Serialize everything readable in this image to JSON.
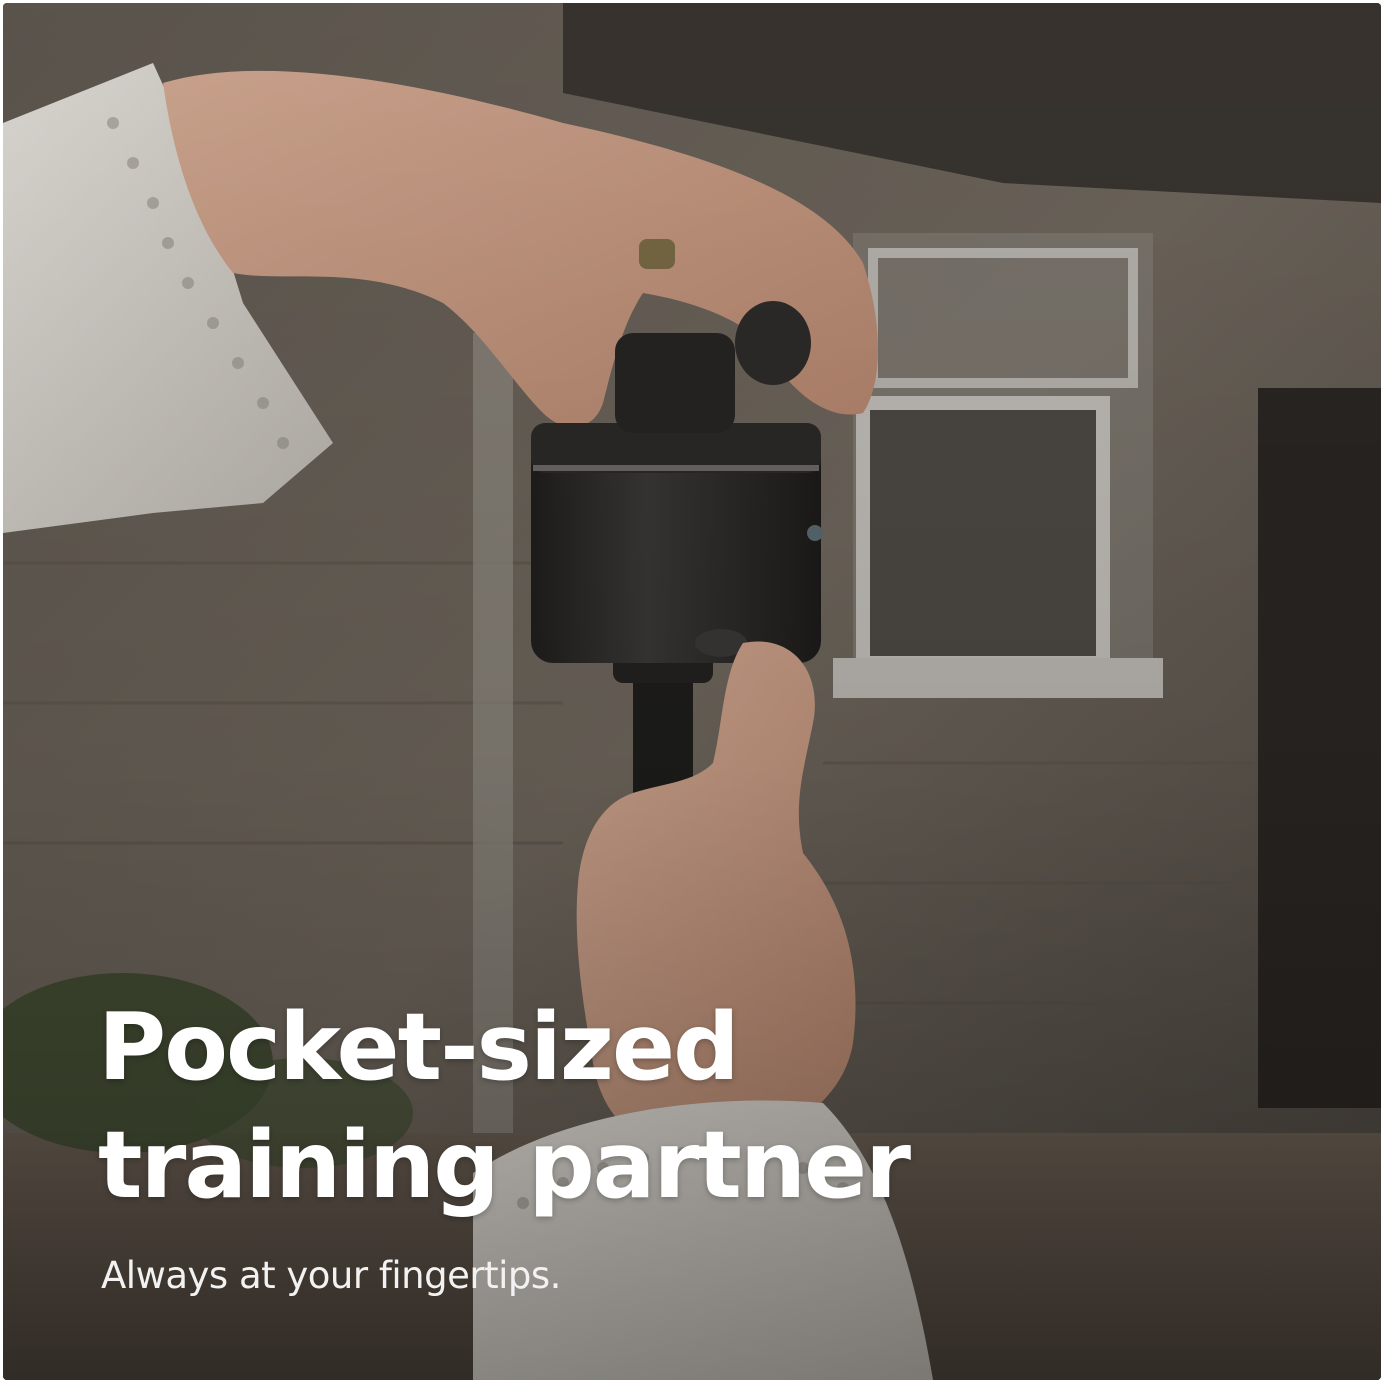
{
  "headline": {
    "line1": "Pocket-sized",
    "line2": "training partner"
  },
  "subheadline": "Always at your fingertips.",
  "colors": {
    "text": "#ffffff",
    "device": "#2a2827",
    "wall": "#6d665e",
    "sleeve": "#d9d5cf",
    "skin": "#c59a84"
  }
}
